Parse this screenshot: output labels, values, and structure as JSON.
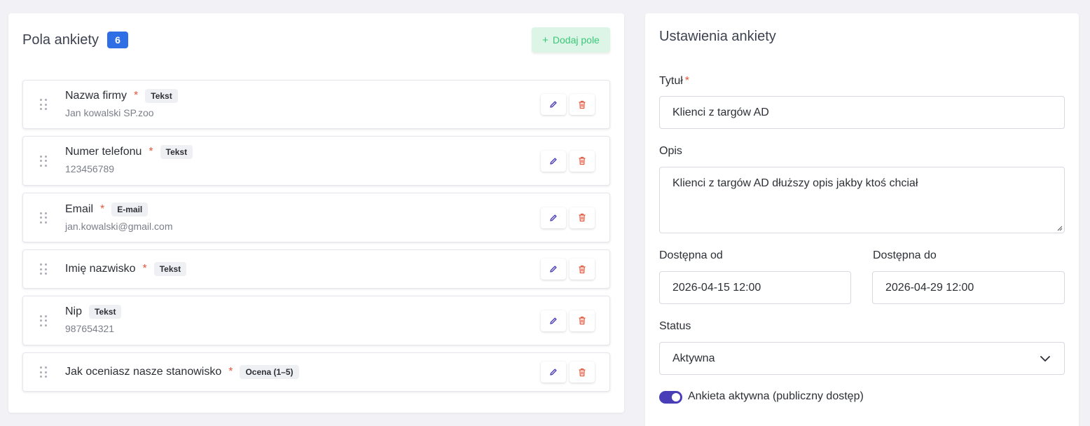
{
  "fields_panel": {
    "title": "Pola ankiety",
    "count": "6",
    "add_button_icon": "+",
    "add_button_label": "Dodaj pole",
    "required_marker": "*",
    "fields": [
      {
        "name": "Nazwa firmy",
        "required": true,
        "type": "Tekst",
        "sample": "Jan kowalski SP.zoo"
      },
      {
        "name": "Numer telefonu",
        "required": true,
        "type": "Tekst",
        "sample": "123456789"
      },
      {
        "name": "Email",
        "required": true,
        "type": "E-mail",
        "sample": "jan.kowalski@gmail.com"
      },
      {
        "name": "Imię nazwisko",
        "required": true,
        "type": "Tekst",
        "sample": ""
      },
      {
        "name": "Nip",
        "required": false,
        "type": "Tekst",
        "sample": "987654321"
      },
      {
        "name": "Jak oceniasz nasze stanowisko",
        "required": true,
        "type": "Ocena (1–5)",
        "sample": ""
      }
    ],
    "icons": {
      "drag": "drag-handle-icon",
      "edit": "pencil-icon",
      "delete": "trash-icon"
    },
    "colors": {
      "badge": "#2f6fe6",
      "add_button_bg": "#dcf5e6",
      "add_button_text": "#3cc678",
      "edit_icon": "#4a3db8",
      "delete_icon": "#e4573d",
      "required": "#e4573d"
    }
  },
  "settings_panel": {
    "title": "Ustawienia ankiety",
    "title_label": "Tytuł",
    "title_required": "*",
    "title_value": "Klienci z targów AD",
    "description_label": "Opis",
    "description_value": "Klienci z targów AD dłuższy opis jakby ktoś chciał",
    "available_from_label": "Dostępna od",
    "available_from_value": "2026-04-15 12:00",
    "available_to_label": "Dostępna do",
    "available_to_value": "2026-04-29 12:00",
    "status_label": "Status",
    "status_value": "Aktywna",
    "toggle_on": true,
    "toggle_label": "Ankieta aktywna (publiczny dostęp)",
    "colors": {
      "toggle": "#4a3db8"
    }
  }
}
